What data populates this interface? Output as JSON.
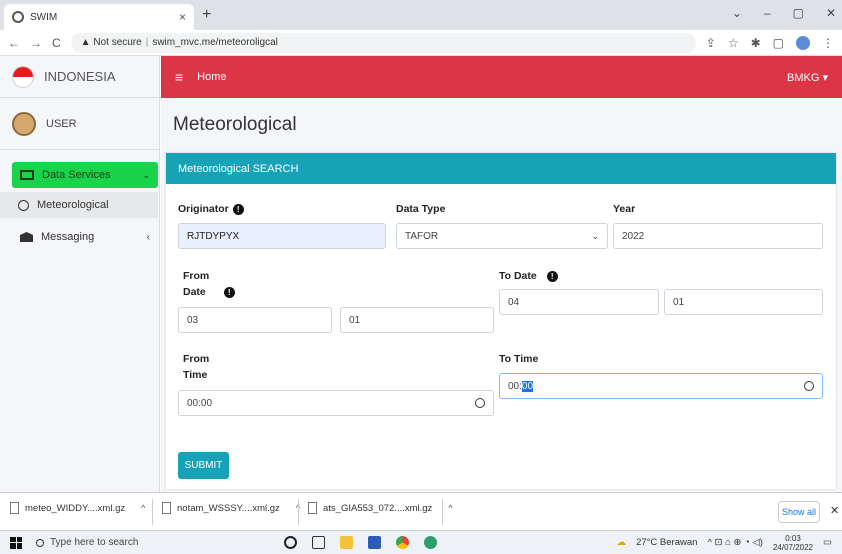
{
  "browser": {
    "tab_title": "SWIM",
    "tab_close": "×",
    "new_tab": "+",
    "url_warning": "▲ Not secure",
    "url_separator": "|",
    "url": "swim_mvc.me/meteoroligcal",
    "nav_back": "←",
    "nav_forward": "→",
    "nav_reload": "C",
    "window_controls": [
      "⌄",
      "–",
      "▢",
      "✕"
    ],
    "addr_icons": [
      "⇪",
      "☆",
      "✱",
      "▢",
      "⋮"
    ]
  },
  "sidebar": {
    "brand": "INDONESIA",
    "user": "USER",
    "items": [
      {
        "label": "Data Services",
        "chevron": "⌄"
      },
      {
        "label": "Meteorological"
      },
      {
        "label": "Messaging",
        "chevron": "‹"
      }
    ]
  },
  "topnav": {
    "menu_icon": "≡",
    "home": "Home",
    "user_menu": "BMKG ▾"
  },
  "page": {
    "title": "Meteorological",
    "card_title": "Meteorological SEARCH",
    "info_glyph": "!",
    "labels": {
      "originator": "Originator",
      "data_type": "Data Type",
      "year": "Year",
      "from_date_line1": "From",
      "from_date_line2": "Date",
      "to_date": "To Date",
      "from_time_line1": "From",
      "from_time_line2": "Time",
      "to_time": "To Time"
    },
    "fields": {
      "originator": "RJTDYPYX",
      "data_type": "TAFOR",
      "data_type_caret": "⌄",
      "year": "2022",
      "from_month": "03",
      "from_day": "01",
      "to_month": "04",
      "to_day": "01",
      "from_time": "00:00",
      "to_time_hours": "00:",
      "to_time_minutes": "00"
    },
    "submit": "SUBMIT"
  },
  "downloads": {
    "items": [
      {
        "name": "meteo_WIDDY....xml.gz"
      },
      {
        "name": "notam_WSSSY....xml.gz"
      },
      {
        "name": "ats_GIA553_072....xml.gz"
      }
    ],
    "up_glyph": "^",
    "show_all": "Show all",
    "close": "✕"
  },
  "taskbar": {
    "search_placeholder": "Type here to search",
    "weather": "27°C Berawan",
    "tray_glyphs": "^  ⊡  ⌂  ⊕  ◔  ◁)",
    "time": "0:03",
    "date": "24/07/2022",
    "notify": "▭"
  },
  "colors": {
    "topnav": "#dc3545",
    "card_header": "#17a2b8",
    "active_nav": "#19d34a"
  }
}
